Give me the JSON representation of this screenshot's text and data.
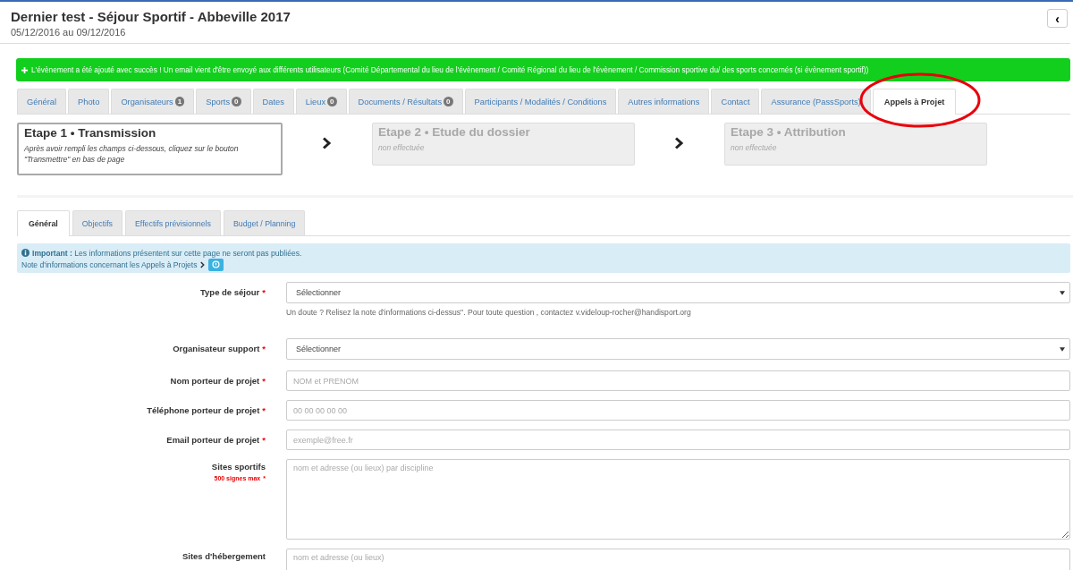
{
  "header": {
    "title": "Dernier test - Séjour Sportif - Abbeville 2017",
    "dates": "05/12/2016 au 09/12/2016",
    "back_button": "‹"
  },
  "alert": {
    "text": "L'évènement a été ajouté avec succès ! Un email vient d'être envoyé aux différents utilisateurs (Comité Départemental du lieu de l'évènement / Comité Régional du lieu de l'évènement / Commission sportive du/ des sports concernés (si évènement sportif))"
  },
  "tabs": [
    {
      "label": "Général",
      "selected": false
    },
    {
      "label": "Photo",
      "selected": false
    },
    {
      "label": "Organisateurs",
      "count": "1",
      "selected": false
    },
    {
      "label": "Sports",
      "count": "0",
      "selected": false
    },
    {
      "label": "Dates",
      "selected": false
    },
    {
      "label": "Lieux",
      "count": "0",
      "selected": false
    },
    {
      "label": "Documents / Résultats",
      "count": "0",
      "selected": false
    },
    {
      "label": "Participants / Modalités / Conditions",
      "selected": false
    },
    {
      "label": "Autres informations",
      "selected": false
    },
    {
      "label": "Contact",
      "selected": false
    },
    {
      "label": "Assurance (PassSports)",
      "selected": false
    },
    {
      "label": "Appels à Projet",
      "selected": true
    }
  ],
  "steps": [
    {
      "title": "Etape 1 • Transmission",
      "description": "Après avoir rempli les champs ci-dessous, cliquez sur le bouton \"Transmettre\" en bas de page",
      "active": true
    },
    {
      "title": "Etape 2 • Etude du dossier",
      "description": "non effectuée",
      "active": false
    },
    {
      "title": "Etape 3 • Attribution",
      "description": "non effectuée",
      "active": false
    }
  ],
  "subtabs": [
    {
      "label": "Général",
      "selected": true
    },
    {
      "label": "Objectifs",
      "selected": false
    },
    {
      "label": "Effectifs prévisionnels",
      "selected": false
    },
    {
      "label": "Budget / Planning",
      "selected": false
    }
  ],
  "info": {
    "text": "**Important :** Les informations présentent sur cette page ne seront pas publiées.",
    "note": "Note d'informations concernant les Appels à Projets"
  },
  "required_mark": "*",
  "form": [
    {
      "kind": "select",
      "label": "Type de séjour",
      "required": true,
      "value": "Sélectionner",
      "help": "Un doute ? Relisez la note d'informations ci-dessus\". Pour toute question , contactez v.videloup-rocher@handisport.org"
    },
    {
      "kind": "select",
      "label": "Organisateur support",
      "required": true,
      "value": "Sélectionner"
    },
    {
      "kind": "input",
      "label": "Nom porteur de projet",
      "required": true,
      "placeholder": "NOM et PRENOM"
    },
    {
      "kind": "input",
      "label": "Téléphone porteur de projet",
      "required": true,
      "placeholder": "00 00 00 00 00"
    },
    {
      "kind": "input",
      "label": "Email porteur de projet",
      "required": true,
      "placeholder": "exemple@free.fr"
    },
    {
      "kind": "textarea",
      "label": "Sites sportifs",
      "limit": "500 signes max",
      "required": true,
      "placeholder": "nom et adresse (ou lieux) par discipline"
    },
    {
      "kind": "textarea",
      "label": "Sites d'hébergement",
      "required": false,
      "placeholder": "nom et adresse (ou lieux)"
    }
  ]
}
